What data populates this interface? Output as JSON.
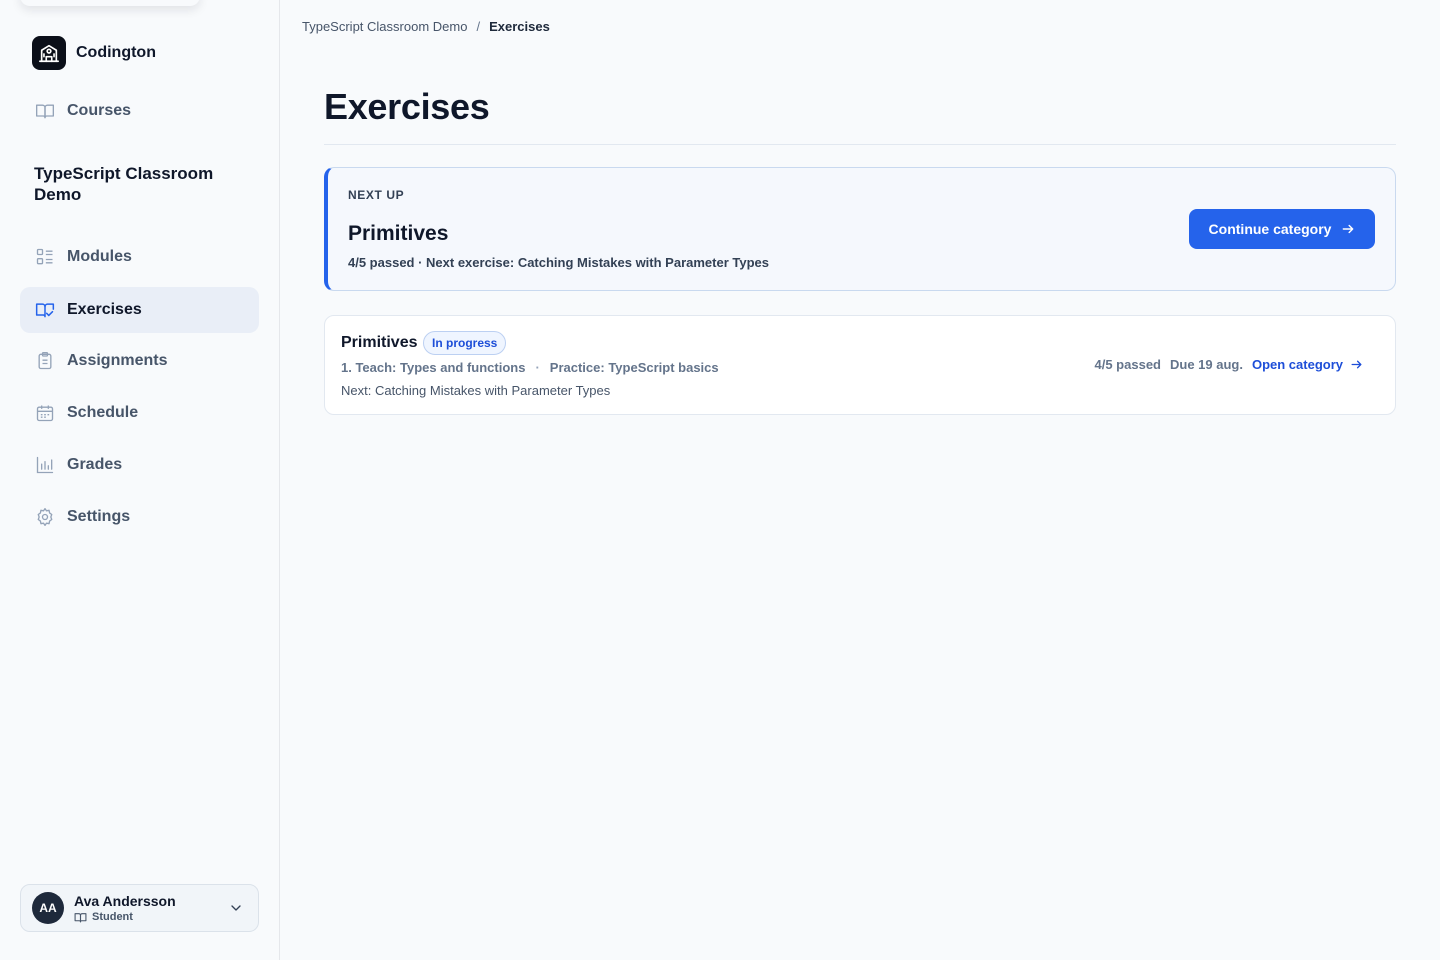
{
  "app": {
    "name": "Codington"
  },
  "sidebar": {
    "top_item": {
      "label": "Courses",
      "icon": "book-open-icon"
    },
    "course_title": "TypeScript Classroom Demo",
    "items": [
      {
        "label": "Modules",
        "icon": "list-icon"
      },
      {
        "label": "Exercises",
        "icon": "book-check-icon",
        "active": true
      },
      {
        "label": "Assignments",
        "icon": "clipboard-icon"
      },
      {
        "label": "Schedule",
        "icon": "calendar-icon"
      },
      {
        "label": "Grades",
        "icon": "bar-chart-icon"
      },
      {
        "label": "Settings",
        "icon": "gear-icon"
      }
    ],
    "user": {
      "initials": "AA",
      "name": "Ava Andersson",
      "role": "Student"
    }
  },
  "breadcrumb": {
    "parent": "TypeScript Classroom Demo",
    "separator": "/",
    "current": "Exercises"
  },
  "page": {
    "title": "Exercises"
  },
  "next_up": {
    "eyebrow": "NEXT UP",
    "title": "Primitives",
    "subtitle": "4/5 passed · Next exercise: Catching Mistakes with Parameter Types",
    "button_label": "Continue category"
  },
  "category": {
    "title": "Primitives",
    "badge": "In progress",
    "tag_1": "1. Teach: Types and functions",
    "tag_separator": "·",
    "tag_2": "Practice: TypeScript basics",
    "next": "Next: Catching Mistakes with Parameter Types",
    "passed": "4/5 passed",
    "due": "Due 19 aug.",
    "link_label": "Open category"
  },
  "colors": {
    "accent": "#2563eb",
    "text": "#0f172a",
    "muted": "#64748b",
    "background": "#f8fafc"
  }
}
